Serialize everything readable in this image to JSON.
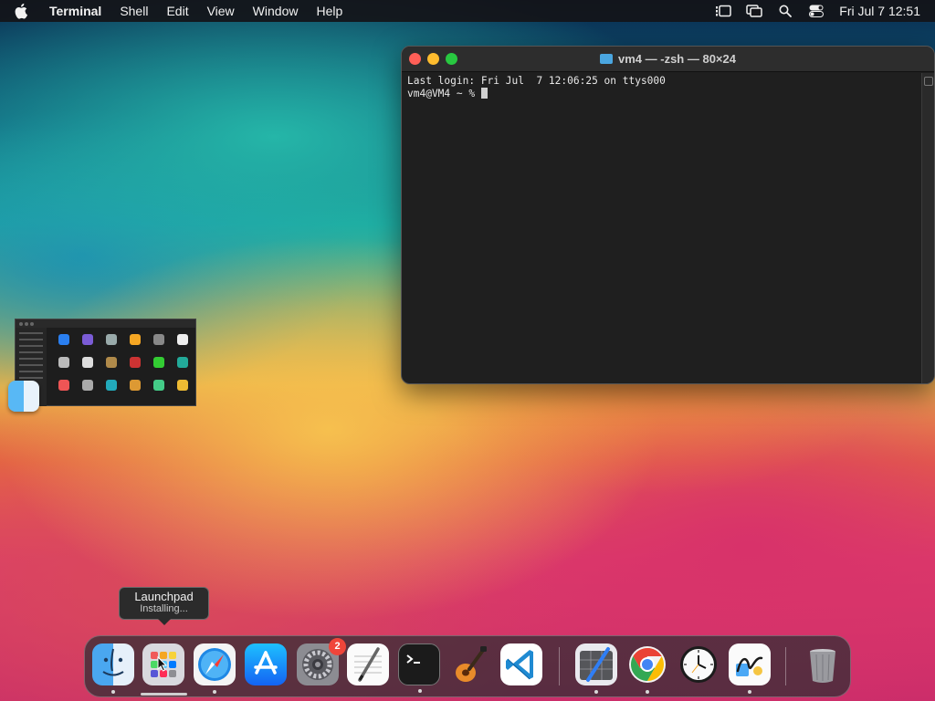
{
  "menubar": {
    "app_name": "Terminal",
    "menus": [
      "Shell",
      "Edit",
      "View",
      "Window",
      "Help"
    ],
    "clock": "Fri Jul 7  12:51"
  },
  "terminal": {
    "title": "vm4 — -zsh — 80×24",
    "lines": [
      "Last login: Fri Jul  7 12:06:25 on ttys000",
      "vm4@VM4 ~ % "
    ]
  },
  "tooltip": {
    "title": "Launchpad",
    "subtitle": "Installing..."
  },
  "dock": {
    "apps": [
      {
        "name": "Finder",
        "icon": "finder-icon",
        "running": true
      },
      {
        "name": "Launchpad",
        "icon": "launchpad-icon",
        "running": false
      },
      {
        "name": "Safari",
        "icon": "safari-icon",
        "running": true
      },
      {
        "name": "App Store",
        "icon": "app-store-icon",
        "running": false
      },
      {
        "name": "System Settings",
        "icon": "system-settings-icon",
        "running": false,
        "badge": "2"
      },
      {
        "name": "TextEdit",
        "icon": "textedit-icon",
        "running": false
      },
      {
        "name": "Terminal",
        "icon": "terminal-icon",
        "running": true
      },
      {
        "name": "GarageBand",
        "icon": "garageband-icon",
        "running": false
      },
      {
        "name": "Visual Studio Code",
        "icon": "vscode-icon",
        "running": false
      },
      {
        "name": "Xcode Instruments",
        "icon": "instruments-icon",
        "running": true
      },
      {
        "name": "Google Chrome",
        "icon": "chrome-icon",
        "running": true
      },
      {
        "name": "Clock",
        "icon": "clock-icon",
        "running": false
      },
      {
        "name": "Freeform",
        "icon": "freeform-icon",
        "running": true
      },
      {
        "name": "Trash",
        "icon": "trash-icon",
        "running": false
      }
    ]
  },
  "colors": {
    "close": "#ff5f57",
    "minimize": "#febc2e",
    "zoom": "#28c840",
    "badge": "#f0453a"
  }
}
